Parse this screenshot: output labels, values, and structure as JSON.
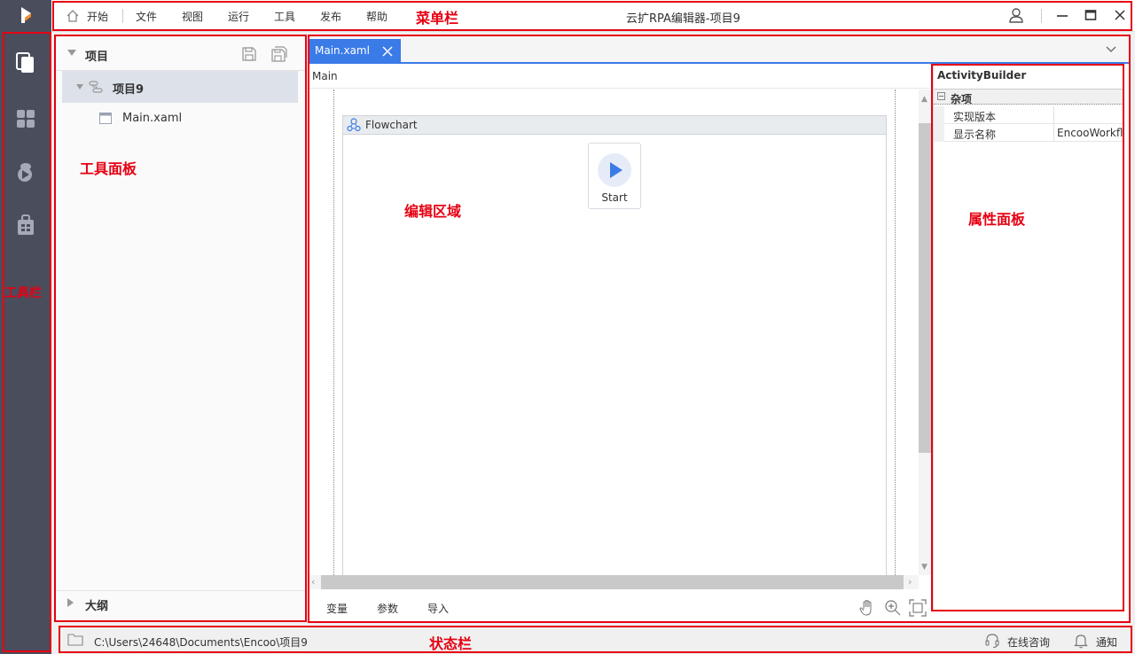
{
  "menu": {
    "items": [
      "开始",
      "文件",
      "视图",
      "运行",
      "工具",
      "发布",
      "帮助"
    ],
    "window_title": "云扩RPA编辑器-项目9"
  },
  "project_panel": {
    "title": "项目",
    "root_label": "项目9",
    "child_label": "Main.xaml",
    "outline_title": "大纲"
  },
  "editor": {
    "tab_label": "Main.xaml",
    "breadcrumb": "Main",
    "flowchart_label": "Flowchart",
    "start_label": "Start",
    "bottom_tabs": [
      "变量",
      "参数",
      "导入"
    ]
  },
  "properties": {
    "title": "ActivityBuilder",
    "category": "杂项",
    "rows": [
      {
        "name": "实现版本",
        "value": ""
      },
      {
        "name": "显示名称",
        "value": "EncooWorkfl"
      }
    ]
  },
  "status": {
    "path": "C:\\Users\\24648\\Documents\\Encoo\\项目9",
    "consult": "在线咨询",
    "notify": "通知"
  },
  "annotations": {
    "menubar": "菜单栏",
    "toolbar": "工具栏",
    "tool_panel": "工具面板",
    "edit_area": "编辑区域",
    "property_panel": "属性面板",
    "statusbar": "状态栏"
  },
  "colors": {
    "accent": "#3b7be8",
    "sidebar": "#4a4d5c",
    "annotation": "#e60012"
  }
}
